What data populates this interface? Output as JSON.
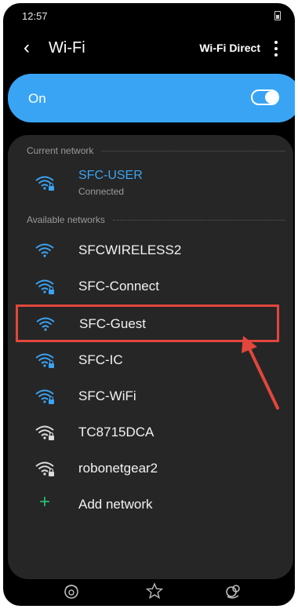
{
  "status": {
    "time": "12:57"
  },
  "header": {
    "title": "Wi-Fi",
    "wifi_direct_label": "Wi-Fi Direct",
    "back_icon": "chevron-left-icon",
    "more_icon": "more-vertical-icon"
  },
  "toggle": {
    "label": "On",
    "state": true,
    "accent": "#3aa4f4"
  },
  "current_network": {
    "heading": "Current network",
    "name": "SFC-USER",
    "status": "Connected",
    "icon": "wifi-lock-icon"
  },
  "available": {
    "heading": "Available networks",
    "networks": [
      {
        "name": "SFCWIRELESS2",
        "icon": "wifi-icon",
        "secured": false
      },
      {
        "name": "SFC-Connect",
        "icon": "wifi-lock-icon",
        "secured": true
      },
      {
        "name": "SFC-Guest",
        "icon": "wifi-icon",
        "secured": false,
        "highlighted": true
      },
      {
        "name": "SFC-IC",
        "icon": "wifi-lock-icon",
        "secured": true
      },
      {
        "name": "SFC-WiFi",
        "icon": "wifi-lock-icon",
        "secured": true
      },
      {
        "name": "TC8715DCA",
        "icon": "wifi-lock-icon",
        "secured": true
      },
      {
        "name": "robonetgear2",
        "icon": "wifi-lock-icon",
        "secured": true
      }
    ],
    "add_label": "Add network",
    "add_icon": "plus-icon"
  },
  "annotation": {
    "highlight_color": "#e2463d"
  },
  "navbar": {
    "left_icon": "recent-apps-icon",
    "center_icon": "star-icon",
    "right_icon": "assistant-icon"
  }
}
